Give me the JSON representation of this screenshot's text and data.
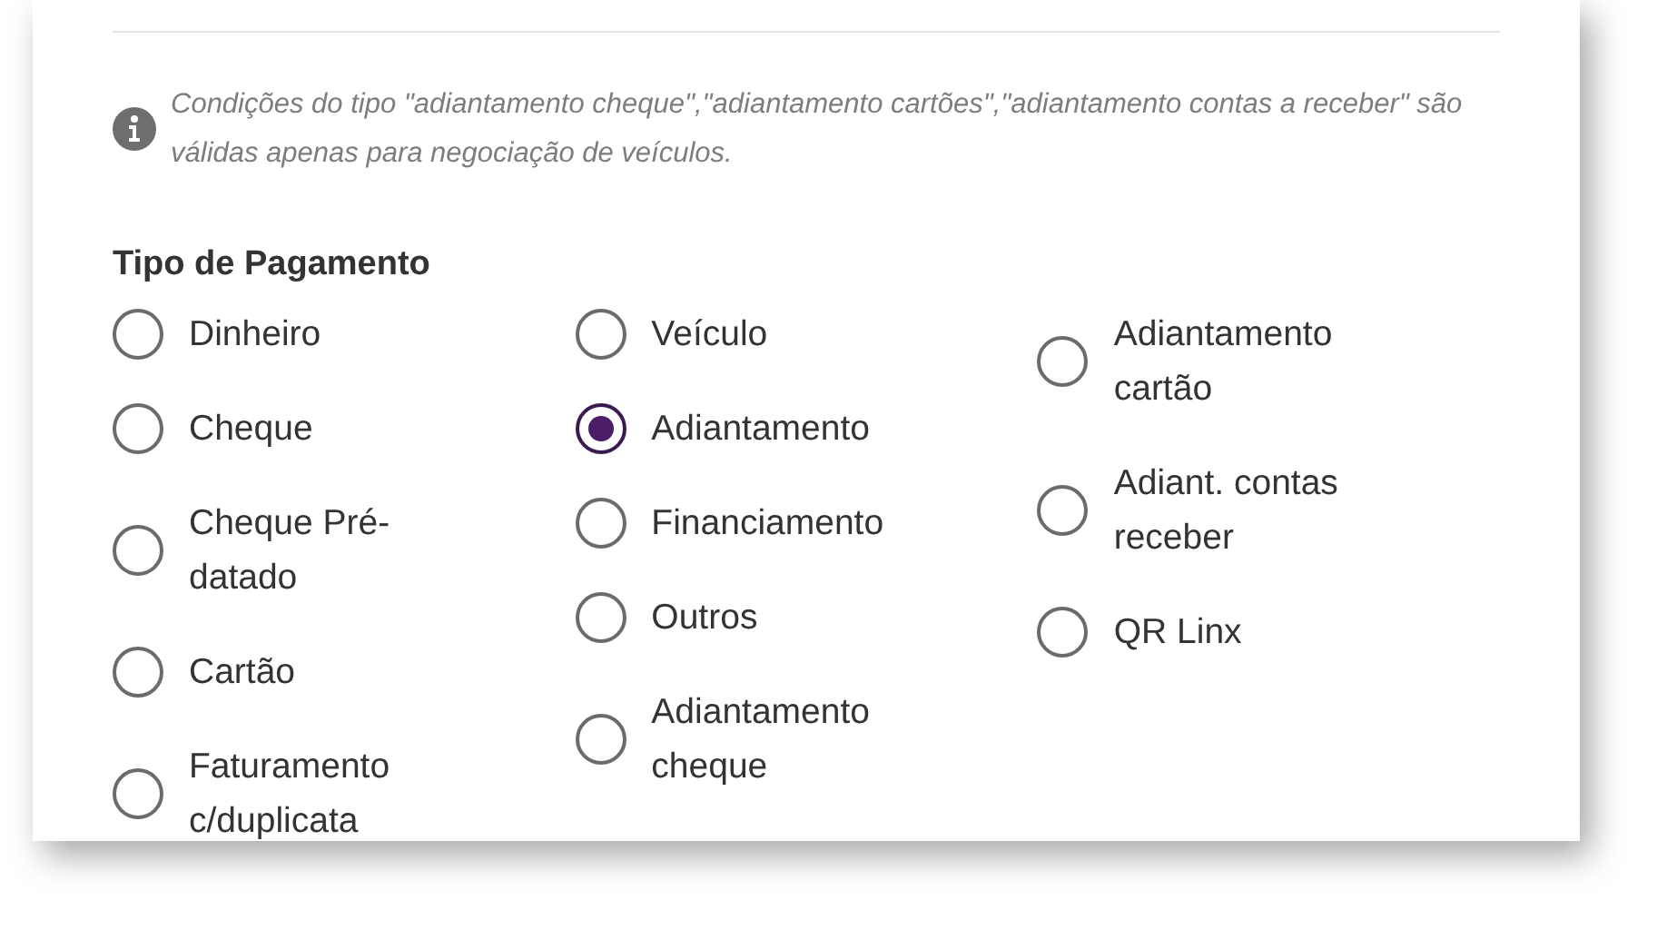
{
  "notice": {
    "text": "Condições do tipo \"adiantamento cheque\",\"adiantamento cartões\",\"adiantamento contas a receber\" são válidas apenas para negociação de veículos."
  },
  "payment_type": {
    "label": "Tipo de Pagamento",
    "columns": [
      [
        {
          "label": "Dinheiro",
          "selected": false
        },
        {
          "label": "Cheque",
          "selected": false
        },
        {
          "label": "Cheque Pré-datado",
          "selected": false
        },
        {
          "label": "Cartão",
          "selected": false
        },
        {
          "label": "Faturamento c/duplicata",
          "selected": false
        }
      ],
      [
        {
          "label": "Veículo",
          "selected": false
        },
        {
          "label": "Adiantamento",
          "selected": true
        },
        {
          "label": "Financiamento",
          "selected": false
        },
        {
          "label": "Outros",
          "selected": false
        },
        {
          "label": "Adiantamento cheque",
          "selected": false
        }
      ],
      [
        {
          "label": "Adiantamento cartão",
          "selected": false
        },
        {
          "label": "Adiant. contas receber",
          "selected": false
        },
        {
          "label": "QR Linx",
          "selected": false
        }
      ]
    ]
  }
}
